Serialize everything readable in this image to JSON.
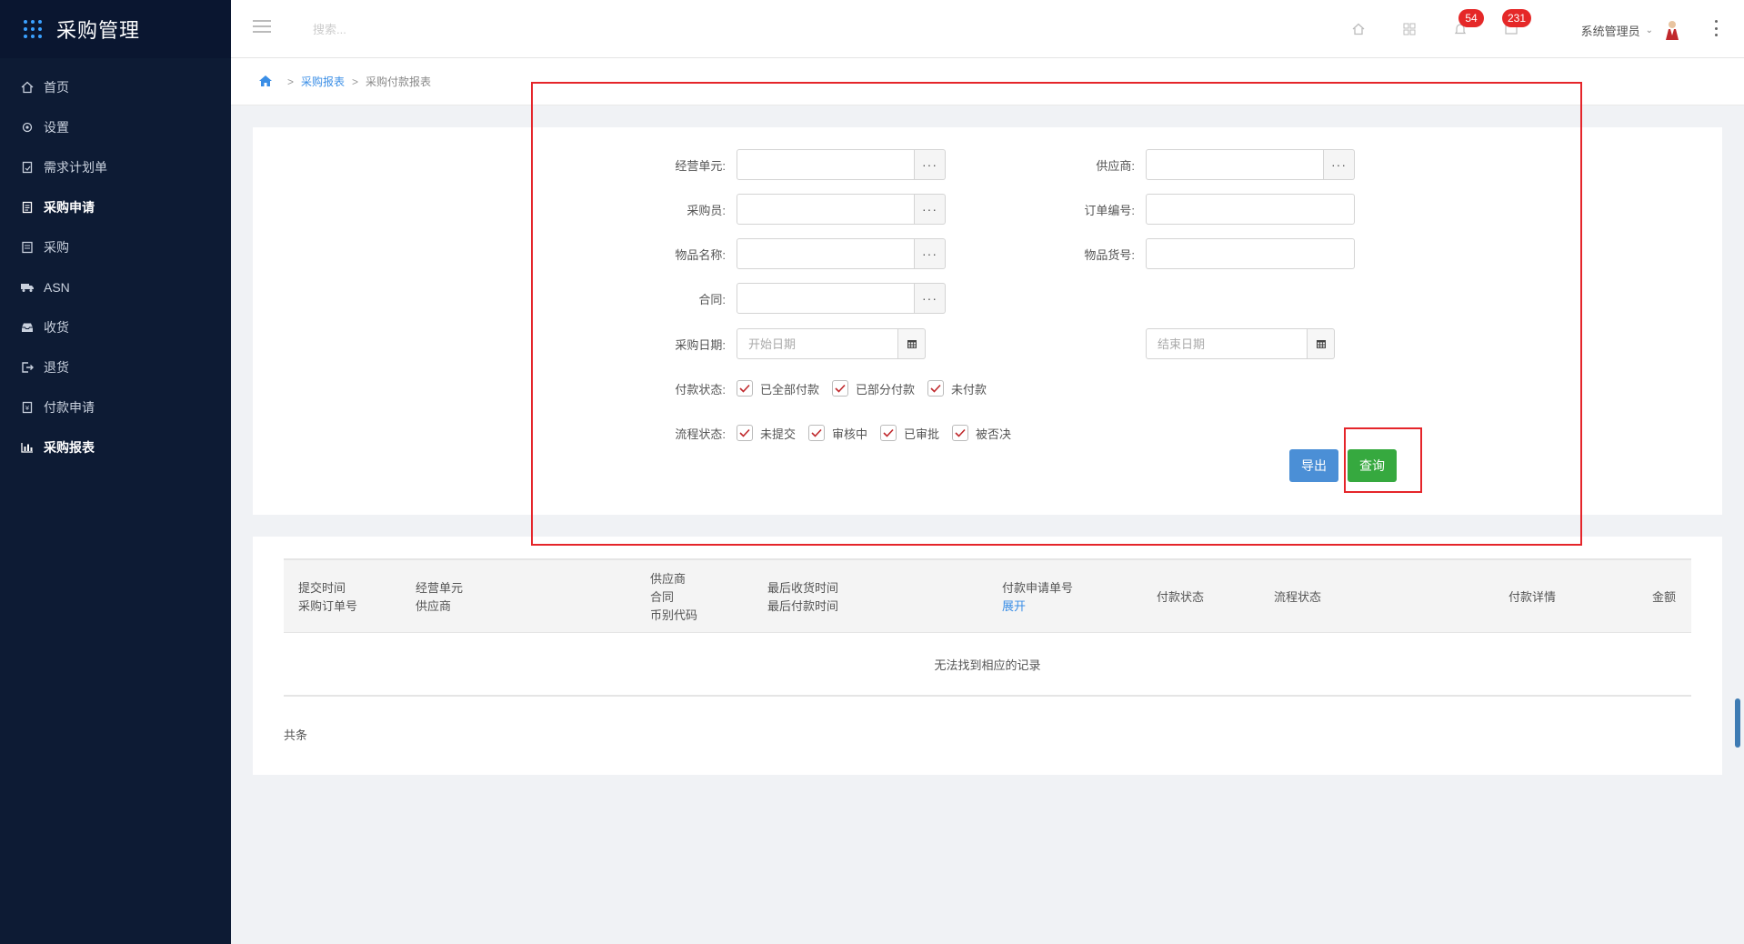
{
  "sidebar": {
    "brand": "采购管理",
    "items": [
      {
        "label": "首页",
        "icon": "home-icon"
      },
      {
        "label": "设置",
        "icon": "gear-icon"
      },
      {
        "label": "需求计划单",
        "icon": "doc-icon"
      },
      {
        "label": "采购申请",
        "icon": "clipboard-icon"
      },
      {
        "label": "采购",
        "icon": "list-icon"
      },
      {
        "label": "ASN",
        "icon": "truck-icon"
      },
      {
        "label": "收货",
        "icon": "inbox-icon"
      },
      {
        "label": "退货",
        "icon": "return-icon"
      },
      {
        "label": "付款申请",
        "icon": "payment-icon"
      },
      {
        "label": "采购报表",
        "icon": "bar-chart-icon"
      }
    ]
  },
  "header": {
    "search_placeholder": "搜索...",
    "bell_badge": "54",
    "mail_badge": "231",
    "username": "系统管理员"
  },
  "breadcrumb": {
    "level1": "采购报表",
    "level2": "采购付款报表",
    "sep": ">"
  },
  "filters": {
    "biz_unit_label": "经营单元:",
    "supplier_label": "供应商:",
    "buyer_label": "采购员:",
    "order_no_label": "订单编号:",
    "item_name_label": "物品名称:",
    "item_code_label": "物品货号:",
    "contract_label": "合同:",
    "purchase_date_label": "采购日期:",
    "start_date_placeholder": "开始日期",
    "end_date_placeholder": "结束日期",
    "payment_status_label": "付款状态:",
    "payment_status_options": [
      "已全部付款",
      "已部分付款",
      "未付款"
    ],
    "flow_status_label": "流程状态:",
    "flow_status_options": [
      "未提交",
      "审核中",
      "已审批",
      "被否决"
    ],
    "export_label": "导出",
    "query_label": "查询"
  },
  "table": {
    "headers": {
      "h1a": "提交时间",
      "h1b": "采购订单号",
      "h2a": "经营单元",
      "h2b": "供应商",
      "h3a": "供应商",
      "h3b": "合同",
      "h3c": "币别代码",
      "h4a": "最后收货时间",
      "h4b": "最后付款时间",
      "h5a": "付款申请单号",
      "h5b": "展开",
      "h6": "付款状态",
      "h7": "流程状态",
      "h8": "付款详情",
      "h9": "金额"
    },
    "empty_text": "无法找到相应的记录",
    "total_text": "共条"
  },
  "colors": {
    "sidebar_bg": "#0d1b34",
    "accent_blue": "#3a8ee6",
    "export_btn": "#4b8fd6",
    "query_btn": "#36a93f",
    "badge_red": "#e52828",
    "annotation_red": "#e5252a"
  }
}
